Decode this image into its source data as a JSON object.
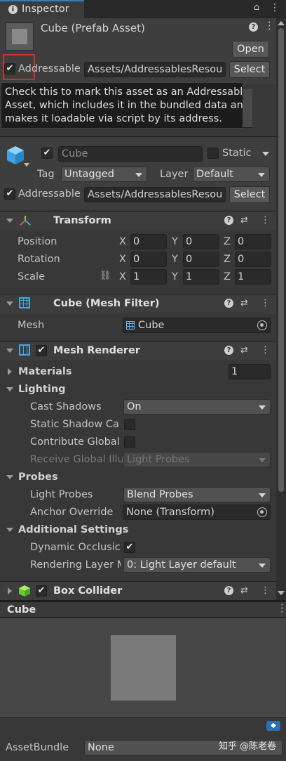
{
  "tab": {
    "icon": "info-icon",
    "title": "Inspector"
  },
  "header": {
    "asset_title": "Cube (Prefab Asset)",
    "open_label": "Open",
    "addressable_label": "Addressable",
    "addressable_path": "Assets/AddressablesResou",
    "select_label": "Select"
  },
  "tooltip": {
    "text_line1": "Check this to mark this asset as an Addressable",
    "text_line2": "Asset, which includes it in the bundled data and",
    "text_line3": "makes it loadable via script by its address."
  },
  "gameobject": {
    "name": "Cube",
    "static_label": "Static",
    "tag_label": "Tag",
    "tag_value": "Untagged",
    "layer_label": "Layer",
    "layer_value": "Default",
    "addressable_label": "Addressable",
    "addressable_path": "Assets/AddressablesResou",
    "select_label": "Select"
  },
  "transform": {
    "title": "Transform",
    "rows": [
      {
        "label": "Position",
        "x": "0",
        "y": "0",
        "z": "0"
      },
      {
        "label": "Rotation",
        "x": "0",
        "y": "0",
        "z": "0"
      },
      {
        "label": "Scale",
        "x": "1",
        "y": "1",
        "z": "1"
      }
    ],
    "axis_x": "X",
    "axis_y": "Y",
    "axis_z": "Z"
  },
  "mesh_filter": {
    "title": "Cube (Mesh Filter)",
    "mesh_label": "Mesh",
    "mesh_value": "Cube"
  },
  "mesh_renderer": {
    "title": "Mesh Renderer",
    "materials_label": "Materials",
    "materials_count": "1",
    "lighting_label": "Lighting",
    "cast_shadows_label": "Cast Shadows",
    "cast_shadows_value": "On",
    "static_shadow_label": "Static Shadow Ca",
    "contribute_gi_label": "Contribute Global",
    "receive_gi_label": "Receive Global Illu",
    "receive_gi_value": "Light Probes",
    "probes_label": "Probes",
    "light_probes_label": "Light Probes",
    "light_probes_value": "Blend Probes",
    "anchor_override_label": "Anchor Override",
    "anchor_override_value": "None (Transform)",
    "additional_settings_label": "Additional Settings",
    "dynamic_occlusion_label": "Dynamic Occlusic",
    "rendering_layer_label": "Rendering Layer M",
    "rendering_layer_value": "0: Light Layer default"
  },
  "box_collider": {
    "title": "Box Collider"
  },
  "preview": {
    "title": "Cube"
  },
  "footer": {
    "assetbundle_label": "AssetBundle",
    "assetbundle_value": "None",
    "watermark": "知乎 @陈老卷"
  }
}
